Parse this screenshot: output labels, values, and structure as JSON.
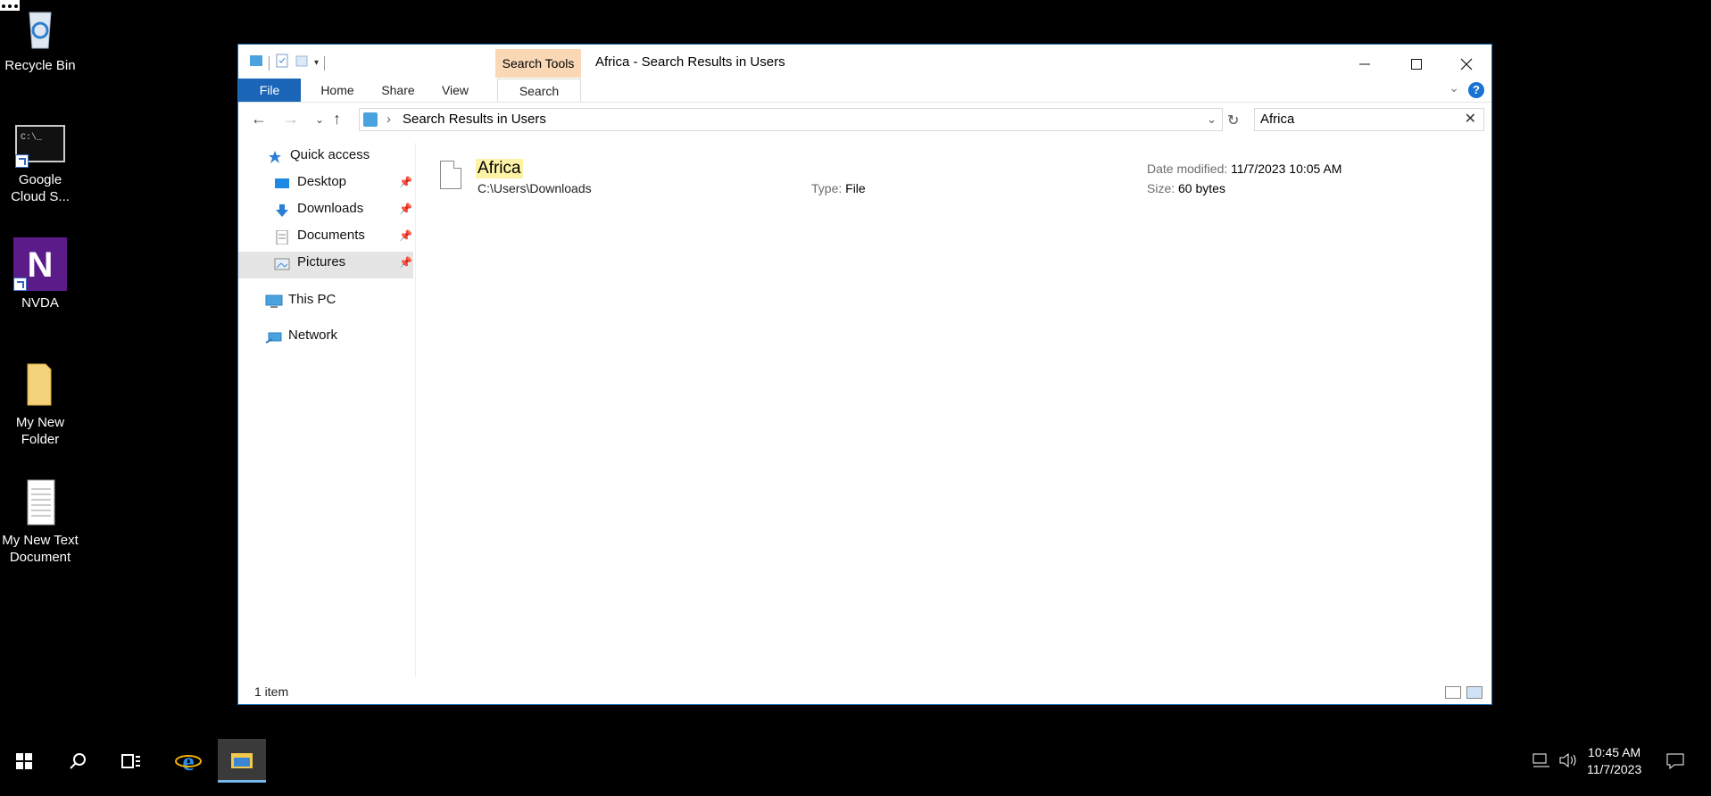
{
  "desktop": {
    "icons": [
      {
        "label": "Recycle Bin"
      },
      {
        "label": "Google Cloud S..."
      },
      {
        "label": "NVDA"
      },
      {
        "label": "My New Folder"
      },
      {
        "label": "My New Text Document"
      }
    ]
  },
  "window": {
    "title": "Africa - Search Results in Users",
    "context_tab": "Search Tools",
    "ribbon_tabs": {
      "file": "File",
      "home": "Home",
      "share": "Share",
      "view": "View",
      "search": "Search"
    },
    "help": "?",
    "address": {
      "path": "Search Results in Users",
      "separator": "›"
    },
    "search": {
      "value": "Africa"
    },
    "nav": {
      "quick_access": "Quick access",
      "desktop": "Desktop",
      "downloads": "Downloads",
      "documents": "Documents",
      "pictures": "Pictures",
      "this_pc": "This PC",
      "network": "Network"
    },
    "results": [
      {
        "name": "Africa",
        "path": "C:\\Users\\Downloads",
        "type_label": "Type:",
        "type": "File",
        "date_label": "Date modified:",
        "date": "11/7/2023 10:05 AM",
        "size_label": "Size:",
        "size": "60 bytes"
      }
    ],
    "status": "1 item"
  },
  "taskbar": {
    "time": "10:45 AM",
    "date": "11/7/2023"
  }
}
